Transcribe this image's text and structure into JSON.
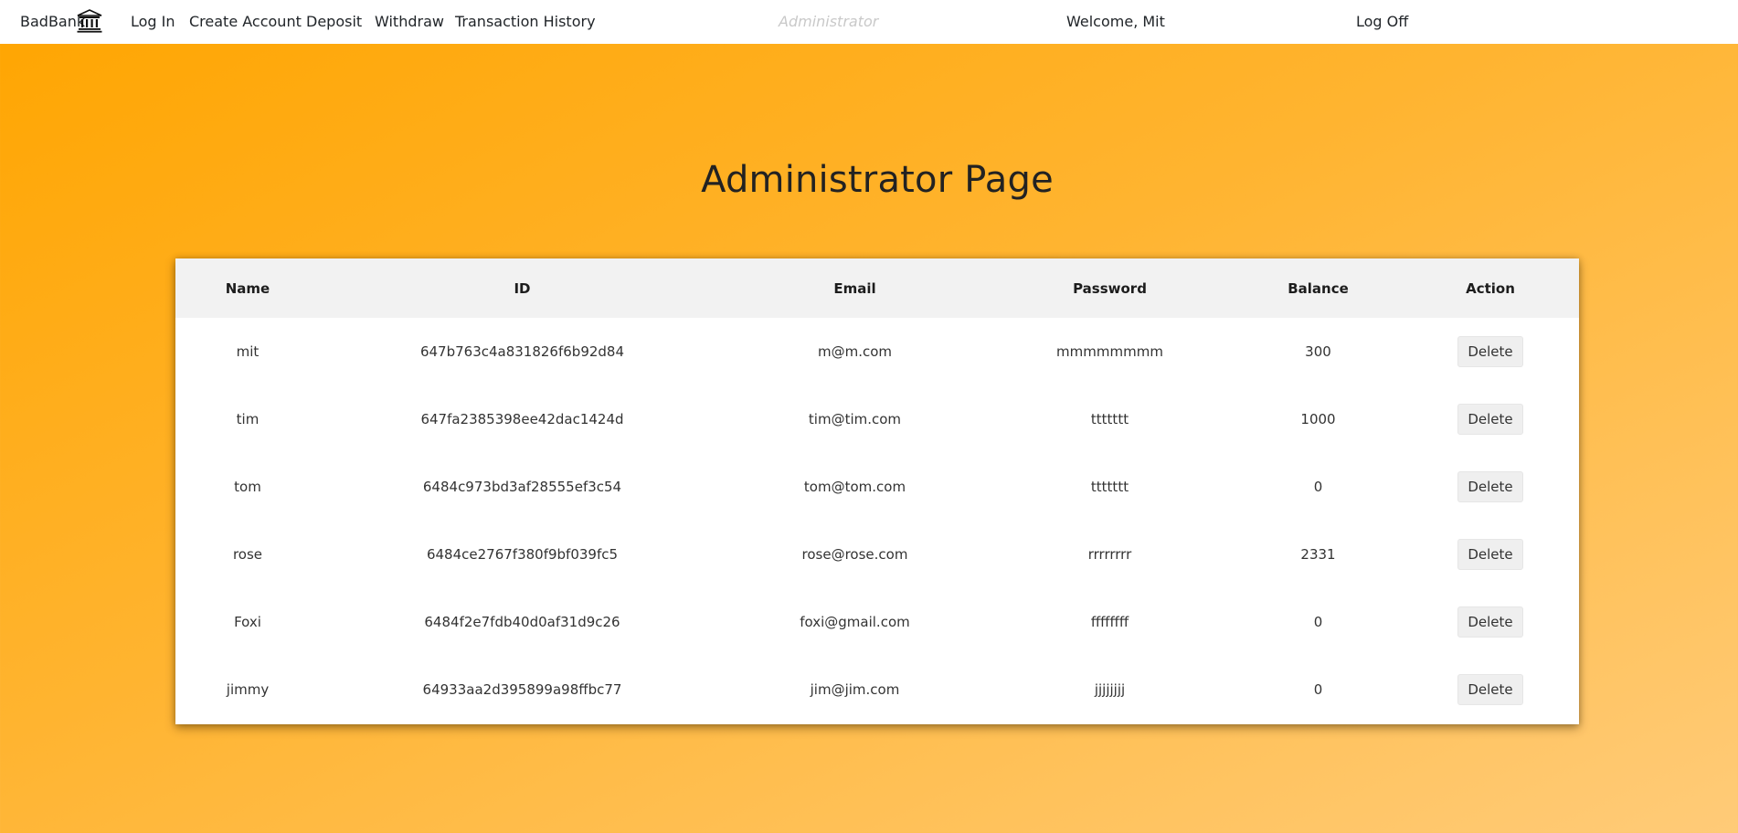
{
  "nav": {
    "brand": "BadBank",
    "brand_icon": "bank-icon",
    "links": {
      "login": "Log In",
      "create": "Create Account",
      "deposit": "Deposit",
      "withdraw": "Withdraw",
      "history": "Transaction History"
    },
    "admin": "Administrator",
    "welcome": "Welcome, Mit",
    "logoff": "Log Off"
  },
  "page": {
    "title": "Administrator Page"
  },
  "table": {
    "headers": {
      "name": "Name",
      "id": "ID",
      "email": "Email",
      "password": "Password",
      "balance": "Balance",
      "action": "Action"
    },
    "rows": [
      {
        "name": "mit",
        "id": "647b763c4a831826f6b92d84",
        "email": "m@m.com",
        "password": "mmmmmmmm",
        "balance": "300",
        "action": "Delete"
      },
      {
        "name": "tim",
        "id": "647fa2385398ee42dac1424d",
        "email": "tim@tim.com",
        "password": "ttttttt",
        "balance": "1000",
        "action": "Delete"
      },
      {
        "name": "tom",
        "id": "6484c973bd3af28555ef3c54",
        "email": "tom@tom.com",
        "password": "ttttttt",
        "balance": "0",
        "action": "Delete"
      },
      {
        "name": "rose",
        "id": "6484ce2767f380f9bf039fc5",
        "email": "rose@rose.com",
        "password": "rrrrrrrr",
        "balance": "2331",
        "action": "Delete"
      },
      {
        "name": "Foxi",
        "id": "6484f2e7fdb40d0af31d9c26",
        "email": "foxi@gmail.com",
        "password": "ffffffff",
        "balance": "0",
        "action": "Delete"
      },
      {
        "name": "jimmy",
        "id": "64933aa2d395899a98ffbc77",
        "email": "jim@jim.com",
        "password": "jjjjjjjj",
        "balance": "0",
        "action": "Delete"
      }
    ]
  },
  "colors": {
    "background_start": "#ffa500",
    "background_end": "#ffcb78",
    "navbar": "#ffffff",
    "header_row": "#f2f2f2",
    "admin_link": "#c9c9c9"
  }
}
